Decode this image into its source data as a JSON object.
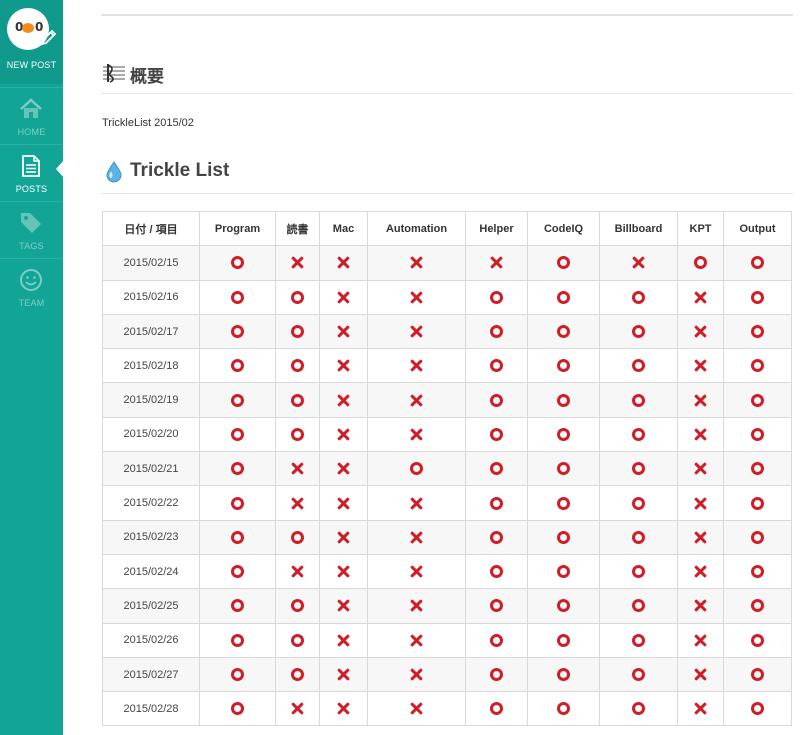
{
  "sidebar": {
    "new_post_label": "NEW POST",
    "items": [
      {
        "label": "HOME",
        "icon": "home-icon",
        "active": false
      },
      {
        "label": "POSTS",
        "icon": "document-icon",
        "active": true
      },
      {
        "label": "TAGS",
        "icon": "tag-icon",
        "active": false
      },
      {
        "label": "TEAM",
        "icon": "smiley-icon",
        "active": false
      }
    ],
    "color": "#12a596"
  },
  "logo": {
    "left_eye": "0",
    "right_eye": "0"
  },
  "summary": {
    "heading": "概要",
    "text": "TrickleList 2015/02"
  },
  "trickle": {
    "heading": "Trickle List",
    "columns": [
      "日付 / 項目",
      "Program",
      "読書",
      "Mac",
      "Automation",
      "Helper",
      "CodeIQ",
      "Billboard",
      "KPT",
      "Output"
    ],
    "rows": [
      {
        "date": "2015/02/15",
        "marks": [
          "o",
          "x",
          "x",
          "x",
          "x",
          "o",
          "x",
          "o",
          "o"
        ]
      },
      {
        "date": "2015/02/16",
        "marks": [
          "o",
          "o",
          "x",
          "x",
          "o",
          "o",
          "o",
          "x",
          "o"
        ]
      },
      {
        "date": "2015/02/17",
        "marks": [
          "o",
          "o",
          "x",
          "x",
          "o",
          "o",
          "o",
          "x",
          "o"
        ]
      },
      {
        "date": "2015/02/18",
        "marks": [
          "o",
          "o",
          "x",
          "x",
          "o",
          "o",
          "o",
          "x",
          "o"
        ]
      },
      {
        "date": "2015/02/19",
        "marks": [
          "o",
          "o",
          "x",
          "x",
          "o",
          "o",
          "o",
          "x",
          "o"
        ]
      },
      {
        "date": "2015/02/20",
        "marks": [
          "o",
          "o",
          "x",
          "x",
          "o",
          "o",
          "o",
          "x",
          "o"
        ]
      },
      {
        "date": "2015/02/21",
        "marks": [
          "o",
          "x",
          "x",
          "o",
          "o",
          "o",
          "o",
          "x",
          "o"
        ]
      },
      {
        "date": "2015/02/22",
        "marks": [
          "o",
          "x",
          "x",
          "x",
          "o",
          "o",
          "o",
          "x",
          "o"
        ]
      },
      {
        "date": "2015/02/23",
        "marks": [
          "o",
          "o",
          "x",
          "x",
          "o",
          "o",
          "o",
          "x",
          "o"
        ]
      },
      {
        "date": "2015/02/24",
        "marks": [
          "o",
          "x",
          "x",
          "x",
          "o",
          "o",
          "o",
          "x",
          "o"
        ]
      },
      {
        "date": "2015/02/25",
        "marks": [
          "o",
          "o",
          "x",
          "x",
          "o",
          "o",
          "o",
          "x",
          "o"
        ]
      },
      {
        "date": "2015/02/26",
        "marks": [
          "o",
          "o",
          "x",
          "x",
          "o",
          "o",
          "o",
          "x",
          "o"
        ]
      },
      {
        "date": "2015/02/27",
        "marks": [
          "o",
          "o",
          "x",
          "x",
          "o",
          "o",
          "o",
          "x",
          "o"
        ]
      },
      {
        "date": "2015/02/28",
        "marks": [
          "o",
          "x",
          "x",
          "x",
          "o",
          "o",
          "o",
          "x",
          "o"
        ]
      }
    ],
    "mark_color": "#d01e28"
  }
}
